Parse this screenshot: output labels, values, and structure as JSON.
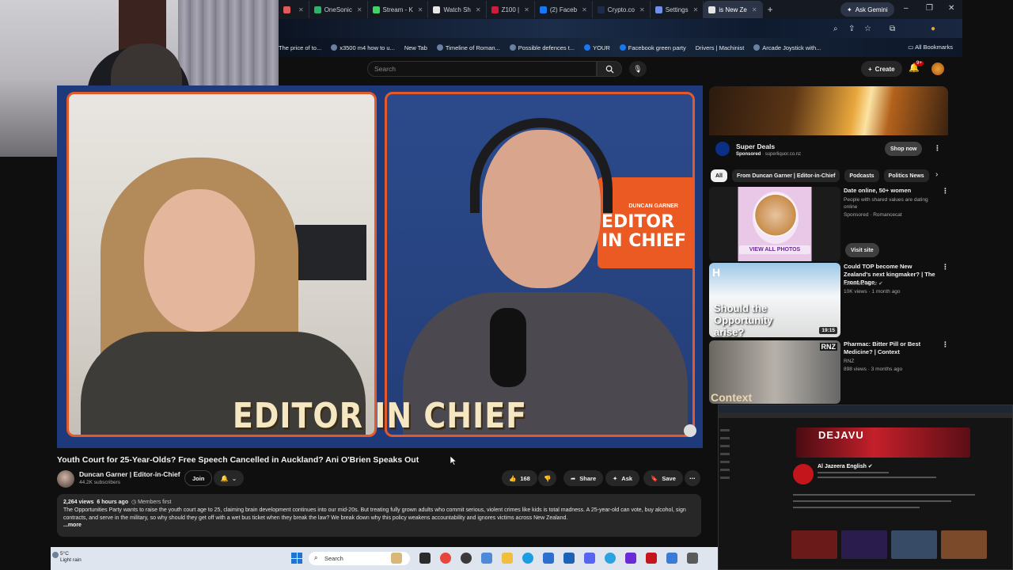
{
  "colors": {
    "youtube_bg": "#0f0f0f",
    "accent_orange": "#e2592b",
    "player_blue": "#1e3a7b",
    "tab_bar": "#151a22"
  },
  "browser": {
    "tabs": [
      {
        "label": "",
        "favicon_color": "#e05a5a"
      },
      {
        "label": "OneSonic",
        "favicon_color": "#2fb36a"
      },
      {
        "label": "Stream - K",
        "favicon_color": "#3fd36a"
      },
      {
        "label": "Watch Sh",
        "favicon_color": "#e6e6e6"
      },
      {
        "label": "Z100 |",
        "favicon_color": "#d01c3a"
      },
      {
        "label": "(2) Faceb",
        "favicon_color": "#1877f2"
      },
      {
        "label": "Crypto.co",
        "favicon_color": "#1c2c4a"
      },
      {
        "label": "Settings",
        "favicon_color": "#6f8fe8"
      },
      {
        "label": "is New Ze",
        "favicon_color": "#e6e6e6"
      }
    ],
    "new_tab_glyph": "+",
    "ask_gemini": "Ask Gemini",
    "window_controls": {
      "minimize": "–",
      "restore": "❐",
      "close": "✕"
    },
    "toolbar_icons": [
      "search-icon",
      "share-icon",
      "star-icon",
      "extensions-icon",
      "profile-icon"
    ],
    "bookmarks": [
      "The price of to...",
      "x3500 m4 how to u...",
      "New Tab",
      "Timeline of Roman...",
      "Possible defences t...",
      "YOUR",
      "Facebook green party",
      "Drivers | Machinist",
      "Arcade Joystick with..."
    ],
    "all_bookmarks": "All Bookmarks"
  },
  "youtube": {
    "search_placeholder": "Search",
    "create_label": "Create",
    "notification_count": "9+",
    "video": {
      "banner_text": "EDITOR IN CHIEF",
      "sign_top": "DUNCAN GARNER",
      "sign_text": "EDITOR\nIN CHIEF",
      "title": "Youth Court for 25-Year-Olds? Free Speech Cancelled in Auckland? Ani O'Brien Speaks Out",
      "channel": "Duncan Garner | Editor-in-Chief",
      "subscribers": "44.2K subscribers",
      "join_label": "Join",
      "likes": "168",
      "share_label": "Share",
      "ask_label": "Ask",
      "save_label": "Save",
      "more_glyph": "⋯",
      "views": "2,264 views",
      "age": "6 hours ago",
      "members_first": "Members first",
      "description": "The Opportunities Party wants to raise the youth court age to 25, claiming brain development continues into our mid-20s. But treating fully grown adults who commit serious, violent crimes like kids is total madness. A 25-year-old can vote, buy alcohol, sign contracts, and serve in the military, so why should they get off with a wet bus ticket when they break the law? We break down why this policy weakens accountability and ignores victims across New Zealand.",
      "more_label": "...more"
    },
    "ad": {
      "title": "Super Deals",
      "sponsored": "Sponsored",
      "domain": "superliquor.co.nz",
      "button": "Shop now"
    },
    "chips": [
      "All",
      "From Duncan Garner | Editor-in-Chief",
      "Podcasts",
      "Politics News"
    ],
    "recommendations": [
      {
        "title": "Date online, 50+ women",
        "line1": "People with shared values are dating online",
        "line2": "Sponsored · Romancecat",
        "thumb_caption": "VIEW ALL PHOTOS",
        "button": "Visit site"
      },
      {
        "title": "Could TOP become New Zealand's next kingmaker? | The Front Page",
        "line1": "nzherald.co.nz ✔",
        "line2": "10K views · 1 month ago",
        "thumb_caption": "Should the Opportunity arise?",
        "thumb_logo": "H",
        "duration": "19:15"
      },
      {
        "title": "Pharmac: Bitter Pill or Best Medicine? | Context",
        "line1": "RNZ",
        "line2": "898 views · 3 months ago",
        "thumb_caption": "Context",
        "thumb_logo": "RNZ"
      }
    ]
  },
  "overlay": {
    "banner_text": "DEJAVU",
    "channel_name": "Al Jazeera English ✔"
  },
  "taskbar": {
    "temperature": "5°C",
    "condition": "Light rain",
    "search_placeholder": "Search"
  }
}
